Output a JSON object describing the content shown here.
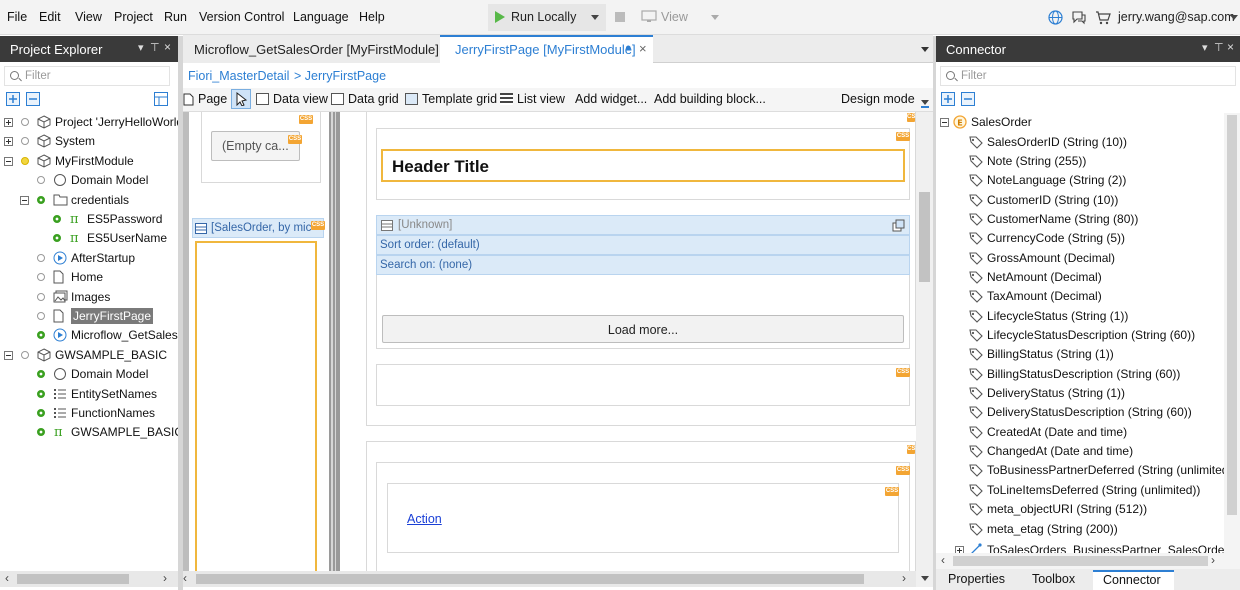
{
  "menu": {
    "items": [
      "File",
      "Edit",
      "View",
      "Project",
      "Run",
      "Version Control",
      "Language",
      "Help"
    ],
    "run_label": "Run Locally",
    "view_label": "View",
    "user": "jerry.wang@sap.com"
  },
  "project_explorer": {
    "title": "Project Explorer",
    "filter_placeholder": "Filter",
    "items": [
      {
        "label": "Project 'JerryHelloWorld'",
        "indent": 0,
        "toggle": "plus",
        "status": "none",
        "icon": "project-icon"
      },
      {
        "label": "System",
        "indent": 0,
        "toggle": "plus",
        "status": "none",
        "icon": "module-icon"
      },
      {
        "label": "MyFirstModule",
        "indent": 0,
        "toggle": "minus",
        "status": "yellow",
        "icon": "module-icon"
      },
      {
        "label": "Domain Model",
        "indent": 1,
        "toggle": "none",
        "status": "none",
        "icon": "domain-model-icon"
      },
      {
        "label": "credentials",
        "indent": 1,
        "toggle": "minus",
        "status": "green",
        "icon": "folder-icon"
      },
      {
        "label": "ES5Password",
        "indent": 2,
        "toggle": "none",
        "status": "green",
        "icon": "constant-icon"
      },
      {
        "label": "ES5UserName",
        "indent": 2,
        "toggle": "none",
        "status": "green",
        "icon": "constant-icon"
      },
      {
        "label": "AfterStartup",
        "indent": 1,
        "toggle": "none",
        "status": "none",
        "icon": "microflow-icon"
      },
      {
        "label": "Home",
        "indent": 1,
        "toggle": "none",
        "status": "none",
        "icon": "page-icon"
      },
      {
        "label": "Images",
        "indent": 1,
        "toggle": "none",
        "status": "none",
        "icon": "images-icon"
      },
      {
        "label": "JerryFirstPage",
        "indent": 1,
        "toggle": "none",
        "status": "none",
        "icon": "page-icon",
        "selected": true
      },
      {
        "label": "Microflow_GetSalesOrder",
        "indent": 1,
        "toggle": "none",
        "status": "green",
        "icon": "microflow-icon"
      },
      {
        "label": "GWSAMPLE_BASIC",
        "indent": 0,
        "toggle": "minus",
        "status": "none",
        "icon": "module-icon"
      },
      {
        "label": "Domain Model",
        "indent": 1,
        "toggle": "none",
        "status": "green",
        "icon": "domain-model-icon"
      },
      {
        "label": "EntitySetNames",
        "indent": 1,
        "toggle": "none",
        "status": "green",
        "icon": "enumeration-icon"
      },
      {
        "label": "FunctionNames",
        "indent": 1,
        "toggle": "none",
        "status": "green",
        "icon": "enumeration-icon"
      },
      {
        "label": "GWSAMPLE_BASIC",
        "indent": 1,
        "toggle": "none",
        "status": "green",
        "icon": "constant-icon"
      }
    ]
  },
  "editor": {
    "tabs": [
      {
        "label": "Microflow_GetSalesOrder [MyFirstModule]",
        "active": false
      },
      {
        "label": "JerryFirstPage [MyFirstModule]",
        "active": true,
        "modified_dot": "●",
        "close": "×"
      }
    ],
    "breadcrumb": [
      "Fiori_MasterDetail",
      "> JerryFirstPage"
    ],
    "toolbar": [
      "Page",
      "Data view",
      "Data grid",
      "Template grid",
      "List view",
      "Add widget...",
      "Add building block..."
    ],
    "design_mode": "Design mode",
    "canvas": {
      "empty_button": "(Empty ca...",
      "sidebar_list_header": "[SalesOrder, by mic",
      "header_title": "Header Title",
      "list_unknown": "[Unknown]",
      "sort_order": "Sort order: (default)",
      "search_on": "Search on: (none)",
      "load_more": "Load more...",
      "action_link": "Action",
      "css_tag": "CSS"
    }
  },
  "connector": {
    "title": "Connector",
    "filter_placeholder": "Filter",
    "root": "SalesOrder",
    "attributes": [
      "SalesOrderID (String (10))",
      "Note (String (255))",
      "NoteLanguage (String (2))",
      "CustomerID (String (10))",
      "CustomerName (String (80))",
      "CurrencyCode (String (5))",
      "GrossAmount (Decimal)",
      "NetAmount (Decimal)",
      "TaxAmount (Decimal)",
      "LifecycleStatus (String (1))",
      "LifecycleStatusDescription (String (60))",
      "BillingStatus (String (1))",
      "BillingStatusDescription (String (60))",
      "DeliveryStatus (String (1))",
      "DeliveryStatusDescription (String (60))",
      "CreatedAt (Date and time)",
      "ChangedAt (Date and time)",
      "ToBusinessPartnerDeferred (String (unlimited))",
      "ToLineItemsDeferred (String (unlimited))",
      "meta_objectURI (String (512))",
      "meta_etag (String (200))"
    ],
    "association": "ToSalesOrders_BusinessPartner_SalesOrder",
    "bottom_tabs": [
      {
        "label": "Properties",
        "active": false
      },
      {
        "label": "Toolbox",
        "active": false
      },
      {
        "label": "Connector",
        "active": true
      }
    ]
  },
  "colors": {
    "accent_blue": "#2d7fd3",
    "css_orange": "#f3a533",
    "header_border": "#f0b73d",
    "panel_header": "#3a3a3a",
    "selection": "#7a7a7a"
  }
}
